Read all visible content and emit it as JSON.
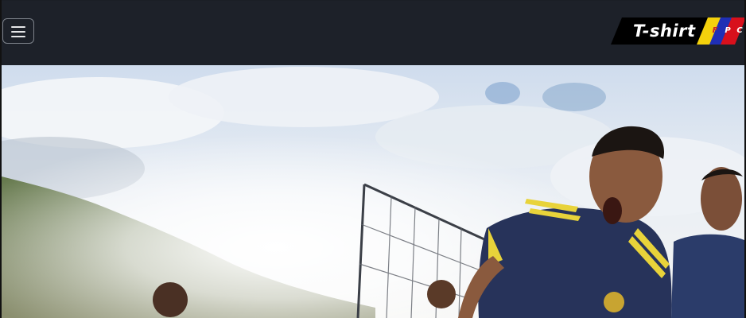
{
  "navbar": {
    "toggler_icon": "hamburger-icon",
    "brand": {
      "text": "T-shirt",
      "tag_letters": [
        "F",
        "P",
        "C"
      ],
      "stripe_colors": [
        "#f4d10c",
        "#1f2fb5",
        "#d8101c"
      ]
    }
  },
  "hero": {
    "description_icon": "hero-photo"
  },
  "colors": {
    "navbar_bg": "#1d2129",
    "sky": "#d9e6f2",
    "jersey": "#27335a",
    "jersey_stripe": "#e8d33a"
  }
}
